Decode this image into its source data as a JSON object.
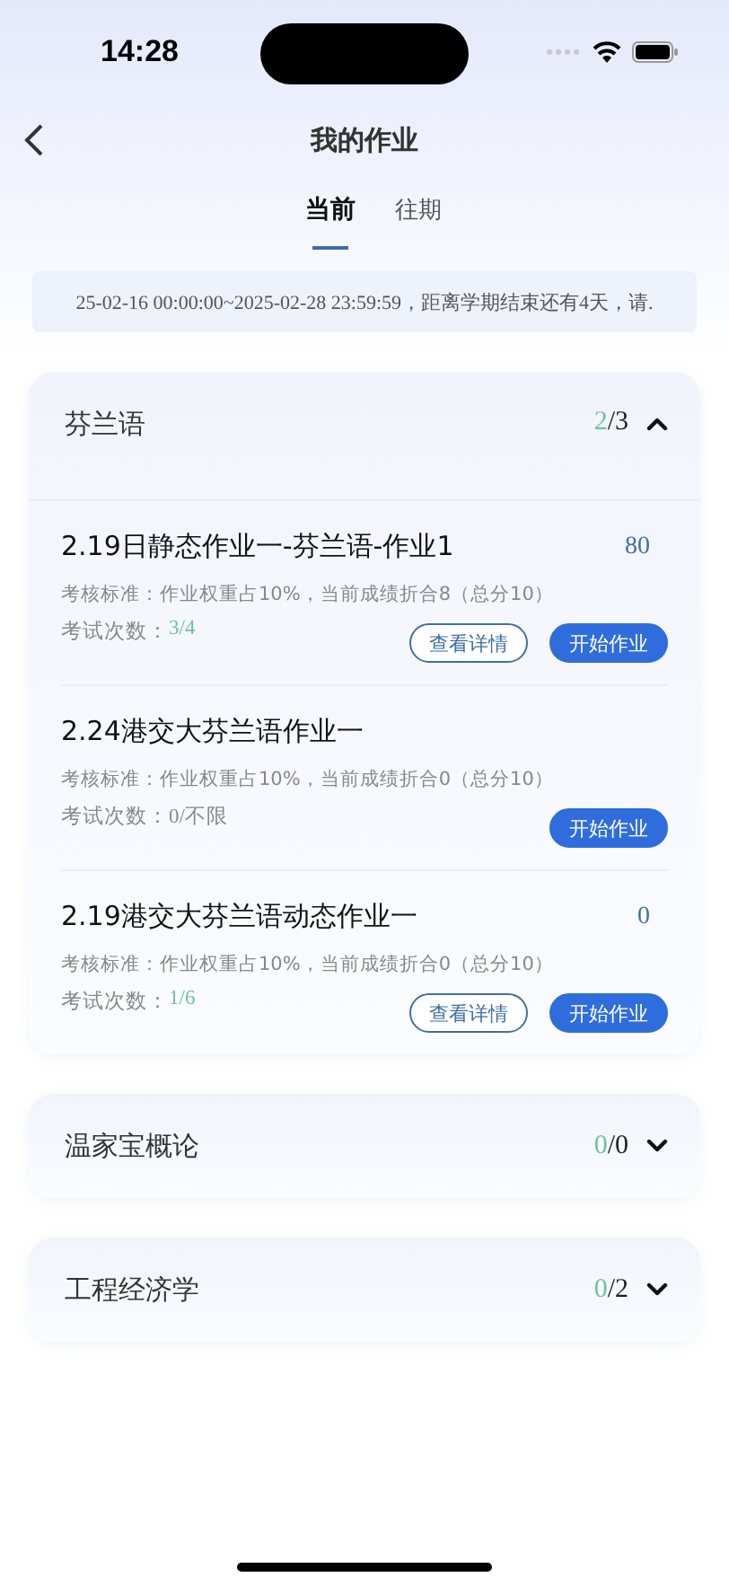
{
  "status_bar": {
    "time": "14:28"
  },
  "nav": {
    "title": "我的作业"
  },
  "tabs": [
    {
      "label": "当前",
      "selected": true
    },
    {
      "label": "往期",
      "selected": false
    }
  ],
  "notice": "25-02-16 00:00:00~2025-02-28 23:59:59，距离学期结束还有4天，请.",
  "courses": [
    {
      "name": "芬兰语",
      "done": "2",
      "total": "/3",
      "expanded": true,
      "assignments": [
        {
          "title": "2.19日静态作业一-芬兰语-作业1",
          "score": "80",
          "criteria": "考核标准：作业权重占10%，当前成绩折合8（总分10）",
          "attempts_label": "考试次数：",
          "attempts": "3/4",
          "attempts_highlight": true,
          "buttons": [
            {
              "label": "查看详情",
              "kind": "outline"
            },
            {
              "label": "开始作业",
              "kind": "filled"
            }
          ]
        },
        {
          "title": "2.24港交大芬兰语作业一",
          "criteria": "考核标准：作业权重占10%，当前成绩折合0（总分10）",
          "attempts_label": "考试次数：",
          "attempts": "0/不限",
          "attempts_highlight": false,
          "buttons": [
            {
              "label": "开始作业",
              "kind": "filled"
            }
          ]
        },
        {
          "title": "2.19港交大芬兰语动态作业一",
          "score": "0",
          "criteria": "考核标准：作业权重占10%，当前成绩折合0（总分10）",
          "attempts_label": "考试次数：",
          "attempts": "1/6",
          "attempts_highlight": true,
          "buttons": [
            {
              "label": "查看详情",
              "kind": "outline"
            },
            {
              "label": "开始作业",
              "kind": "filled"
            }
          ]
        }
      ]
    },
    {
      "name": "温家宝概论",
      "done": "0",
      "total": "/0",
      "expanded": false
    },
    {
      "name": "工程经济学",
      "done": "0",
      "total": "/2",
      "expanded": false
    }
  ]
}
